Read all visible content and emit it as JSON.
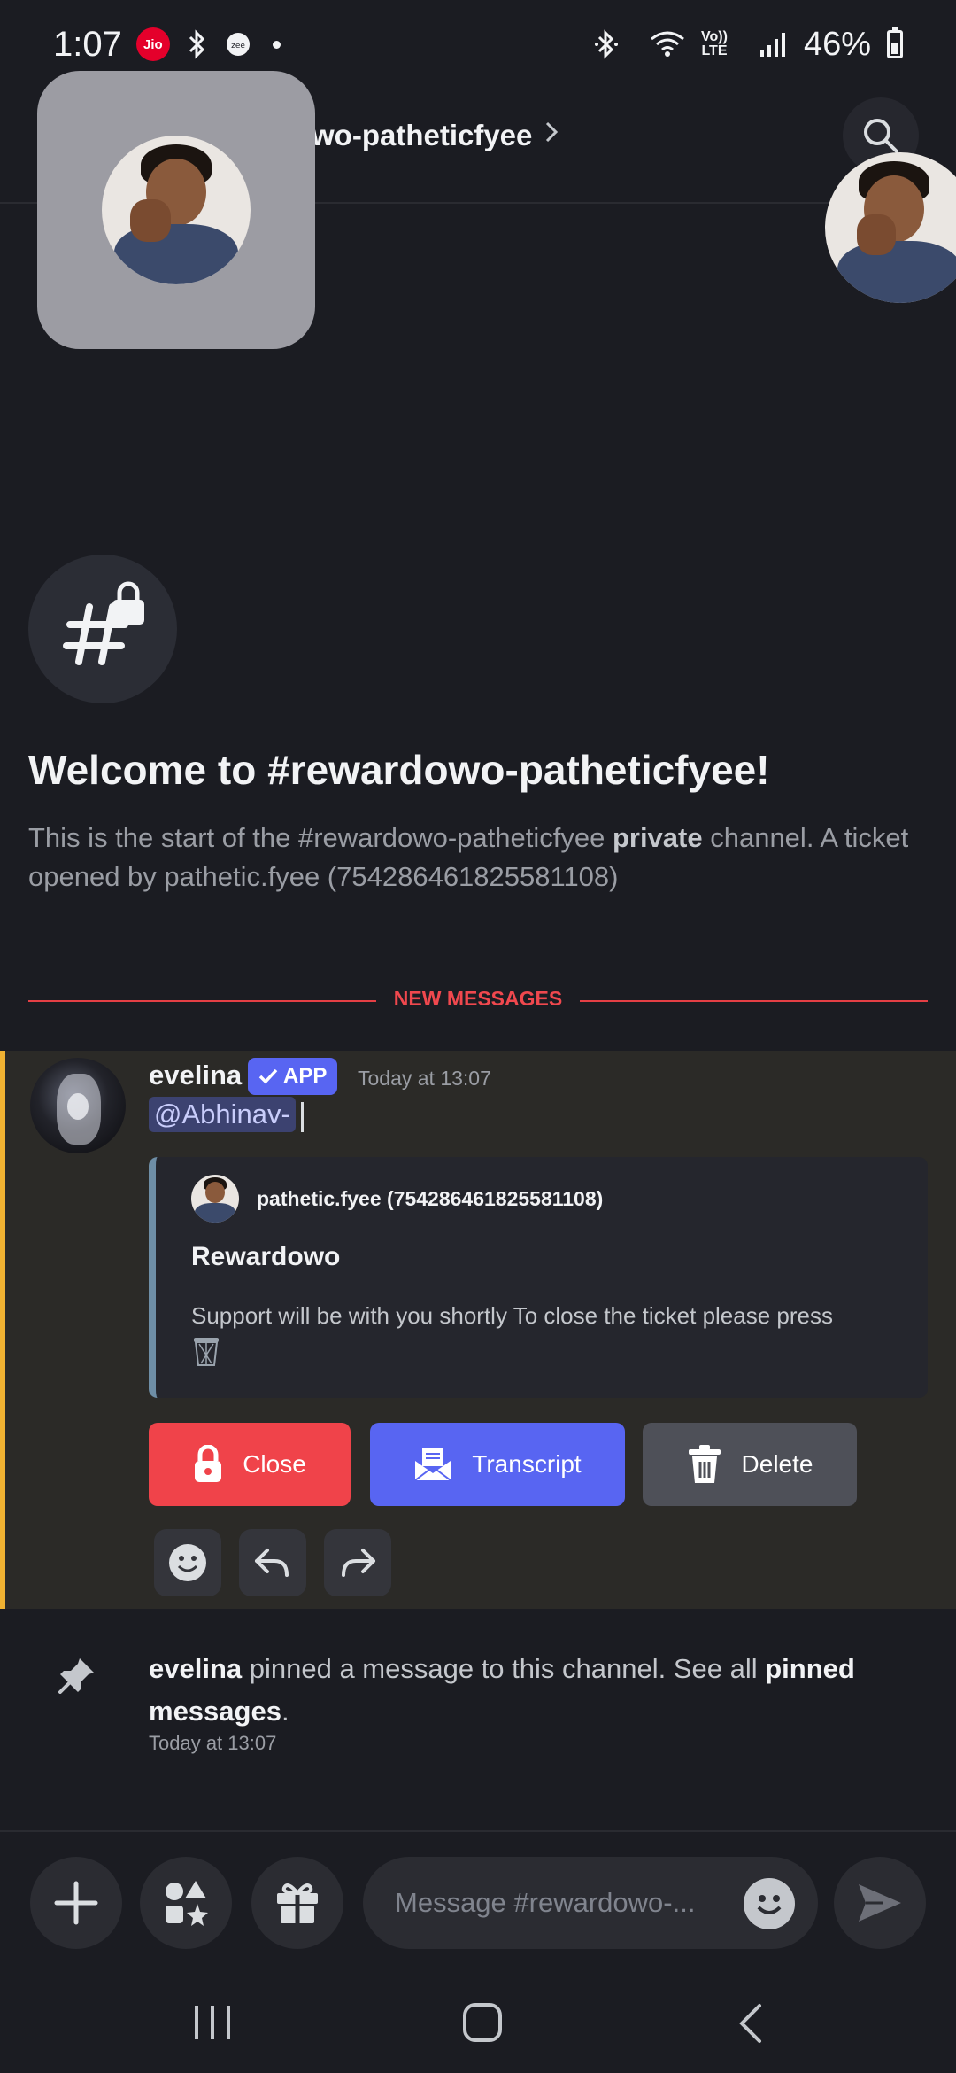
{
  "status_bar": {
    "time": "1:07",
    "carrier_badge": "Jio",
    "volte_line1": "Vo))",
    "volte_line2": "LTE",
    "battery": "46%",
    "battery_level": 0.46
  },
  "header": {
    "channel_title": "wo-patheticfyee"
  },
  "welcome": {
    "title": "Welcome to #rewardowo-patheticfyee!",
    "desc_part1": "This is the start of the #rewardowo-patheticfyee ",
    "desc_bold": "private",
    "desc_part2": " channel. A ticket opened by pathetic.fyee (754286461825581108)"
  },
  "divider": {
    "label": "NEW MESSAGES"
  },
  "message": {
    "author": "evelina",
    "badge": "APP",
    "time": "Today at 13:07",
    "mention": "@Abhinav-",
    "embed": {
      "author": "pathetic.fyee (754286461825581108)",
      "title": "Rewardowo",
      "description": "Support will be with you shortly To close the ticket please press"
    },
    "buttons": {
      "close": "Close",
      "transcript": "Transcript",
      "delete": "Delete"
    }
  },
  "system": {
    "author": "evelina",
    "text_middle": " pinned a message to this channel. See all ",
    "link": "pinned messages",
    "suffix": ".",
    "time": "Today at 13:07"
  },
  "composer": {
    "placeholder": "Message #rewardowo-..."
  },
  "colors": {
    "accent": "#5865f2",
    "danger": "#f0434a",
    "highlight_bar": "#f0b232",
    "new_messages": "#e53f45"
  }
}
